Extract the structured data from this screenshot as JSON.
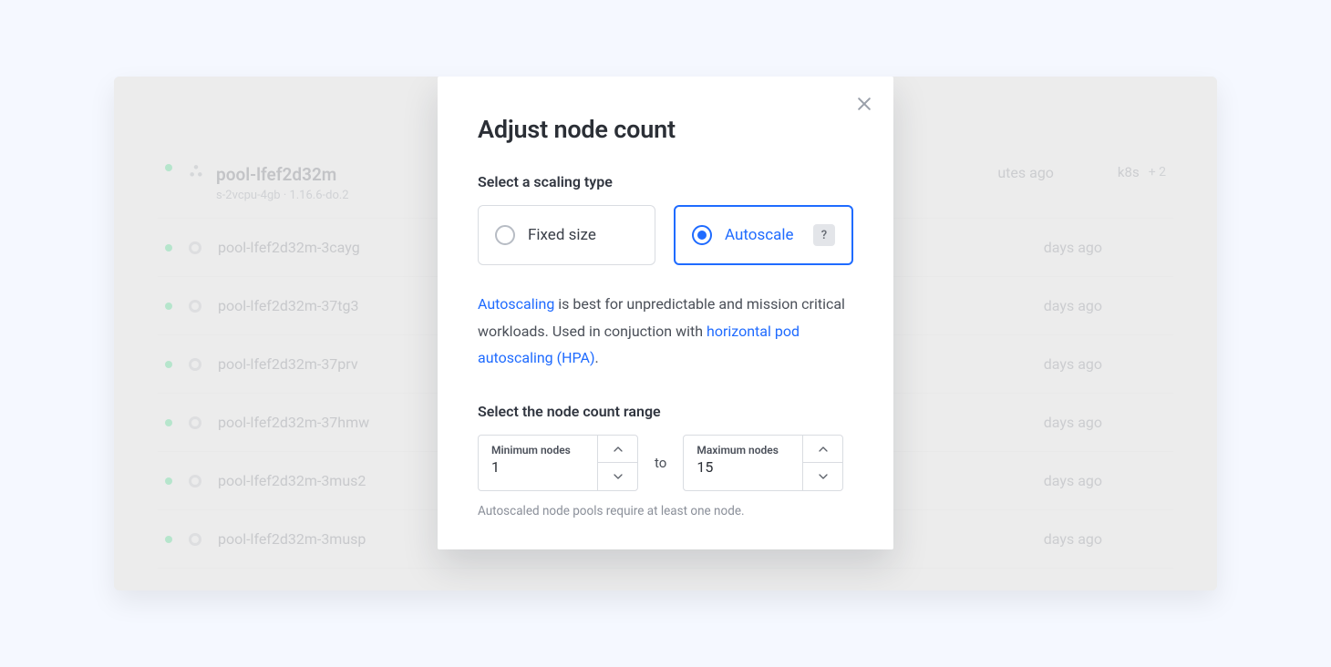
{
  "pool": {
    "title": "pool-lfef2d32m",
    "subtitle": "s-2vcpu-4gb · 1.16.6-do.2",
    "header_time": "utes ago",
    "tag1": "k8s",
    "tag_more": "+ 2"
  },
  "nodes": [
    {
      "name": "pool-lfef2d32m-3cayg",
      "time": "days ago"
    },
    {
      "name": "pool-lfef2d32m-37tg3",
      "time": "days ago"
    },
    {
      "name": "pool-lfef2d32m-37prv",
      "time": "days ago"
    },
    {
      "name": "pool-lfef2d32m-37hmw",
      "time": "days ago"
    },
    {
      "name": "pool-lfef2d32m-3mus2",
      "time": "days ago"
    },
    {
      "name": "pool-lfef2d32m-3musp",
      "time": "days ago"
    }
  ],
  "modal": {
    "title": "Adjust node count",
    "section_scaling": "Select a scaling type",
    "option_fixed": "Fixed size",
    "option_autoscale": "Autoscale",
    "help_icon_text": "?",
    "desc_link1": "Autoscaling",
    "desc_text1": " is best for unpredictable and mission critical workloads. Used in conjuction with ",
    "desc_link2": "horizontal pod autoscaling (HPA)",
    "desc_period": ".",
    "section_range": "Select the node count range",
    "min_label": "Minimum nodes",
    "min_value": "1",
    "to_label": "to",
    "max_label": "Maximum nodes",
    "max_value": "15",
    "helper": "Autoscaled node pools require at least one node."
  }
}
